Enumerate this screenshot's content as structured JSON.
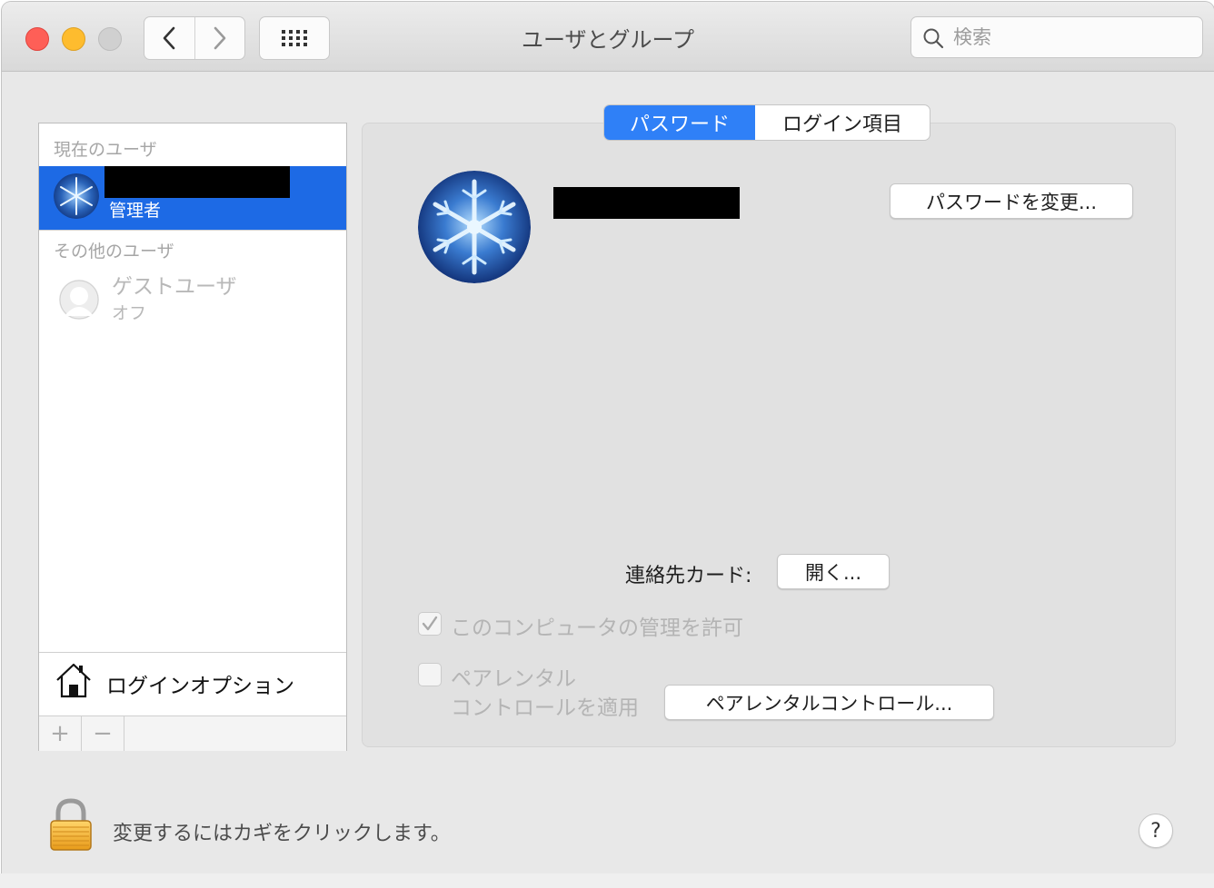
{
  "window": {
    "title": "ユーザとグループ",
    "search_placeholder": "検索",
    "buttons": {
      "back": "chevron-left-icon",
      "forward": "chevron-right-icon",
      "show_all": "grid-icon"
    }
  },
  "sidebar": {
    "current_users_label": "現在のユーザ",
    "current_user": {
      "role": "管理者",
      "name_redacted": true,
      "avatar": "snowflake-avatar"
    },
    "other_users_label": "その他のユーザ",
    "guest": {
      "name": "ゲストユーザ",
      "status": "オフ",
      "avatar": "user-silhouette-icon"
    },
    "login_options_label": "ログインオプション",
    "add_button": "+",
    "remove_button": "−"
  },
  "tabs": [
    {
      "label": "パスワード",
      "selected": true
    },
    {
      "label": "ログイン項目",
      "selected": false
    }
  ],
  "main": {
    "change_password_button": "パスワードを変更...",
    "contact_card_label": "連絡先カード:",
    "open_button": "開く...",
    "allow_admin_label": "このコンピュータの管理を許可",
    "allow_admin_checked": true,
    "parental_label_line1": "ペアレンタル",
    "parental_label_line2": "コントロールを適用",
    "parental_checked": false,
    "parental_button": "ペアレンタルコントロール..."
  },
  "footer": {
    "lock_text": "変更するにはカギをクリックします。",
    "help_button": "?"
  },
  "colors": {
    "accent": "#2f80f7",
    "selection": "#1d6ae5",
    "close": "#fe5f57",
    "minimize": "#febc2e"
  }
}
